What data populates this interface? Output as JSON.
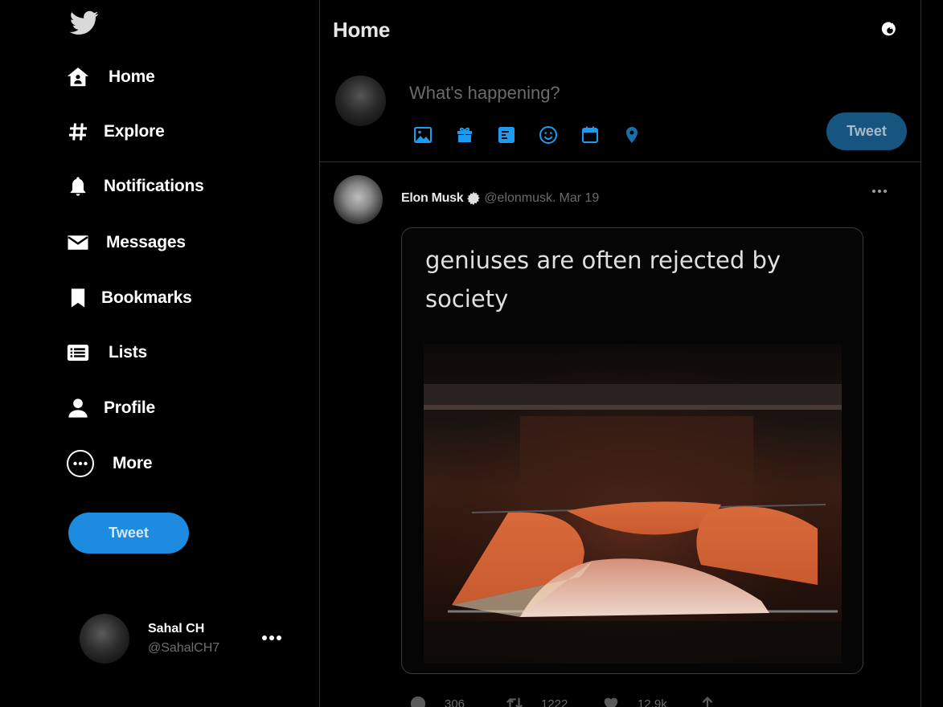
{
  "sidebar": {
    "logo": "twitter-bird-icon",
    "items": [
      {
        "label": "Home",
        "icon": "home-icon"
      },
      {
        "label": "Explore",
        "icon": "hashtag-icon"
      },
      {
        "label": "Notifications",
        "icon": "bell-icon"
      },
      {
        "label": "Messages",
        "icon": "envelope-icon"
      },
      {
        "label": "Bookmarks",
        "icon": "bookmark-icon"
      },
      {
        "label": "Lists",
        "icon": "list-icon"
      },
      {
        "label": "Profile",
        "icon": "person-icon"
      },
      {
        "label": "More",
        "icon": "more-circle-icon"
      }
    ],
    "tweet_button": "Tweet",
    "account": {
      "name": "Sahal CH",
      "handle": "@SahalCH7"
    }
  },
  "main": {
    "title": "Home",
    "top_icon": "sparkle-icon",
    "compose": {
      "placeholder": "What's happening?",
      "icons": [
        "image-icon",
        "gif-icon",
        "poll-icon",
        "emoji-icon",
        "schedule-icon",
        "location-icon"
      ],
      "tweet_button": "Tweet"
    },
    "tweet": {
      "author": "Elon Musk",
      "verified": true,
      "handle": "@elonmusk.",
      "date": "Mar 19",
      "media_caption": "geniuses are often rejected by society",
      "actions": [
        {
          "icon": "reply-icon",
          "count": "306"
        },
        {
          "icon": "retweet-icon",
          "count": "1222"
        },
        {
          "icon": "like-icon",
          "count": "12.9k"
        },
        {
          "icon": "share-icon",
          "count": ""
        }
      ]
    }
  },
  "colors": {
    "accent": "#1d8ce0",
    "accent_dim": "#16557f",
    "background": "#000000",
    "border": "#2f2f2f",
    "muted_text": "#6a6a6a"
  }
}
